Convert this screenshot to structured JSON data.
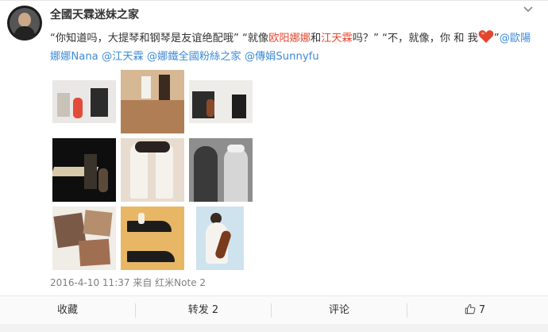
{
  "post": {
    "username": "全國天霖迷妹之家",
    "text_parts": {
      "p1": "“你知道吗，大提琴和钢琴是友谊绝配哦” “就像",
      "p2": "欧阳娜娜",
      "p3": "和",
      "p4": "江天霖",
      "p5": "吗？” “不，就像，你 和 我",
      "p6": "”",
      "m1": "@歐陽娜娜Nana",
      "m2": "@江天霖",
      "m3": "@娜鐵全國粉絲之家",
      "m4": "@傳娟Sunnyfu"
    },
    "images": [
      {
        "name": "photo-1"
      },
      {
        "name": "photo-2"
      },
      {
        "name": "photo-3"
      },
      {
        "name": "photo-4"
      },
      {
        "name": "photo-5"
      },
      {
        "name": "photo-6"
      },
      {
        "name": "photo-7"
      },
      {
        "name": "photo-8"
      },
      {
        "name": "photo-9"
      }
    ],
    "meta": {
      "date": "2016-4-10 11:37",
      "source_prefix": "来自",
      "source": "红米Note 2"
    }
  },
  "actions": {
    "favorite": "收藏",
    "repost": "转发 2",
    "comment": "评论",
    "like_count": "7"
  },
  "colors": {
    "highlight_red": "#e3462f",
    "mention_blue": "#3d8ad8",
    "heart": "#e3462f"
  }
}
